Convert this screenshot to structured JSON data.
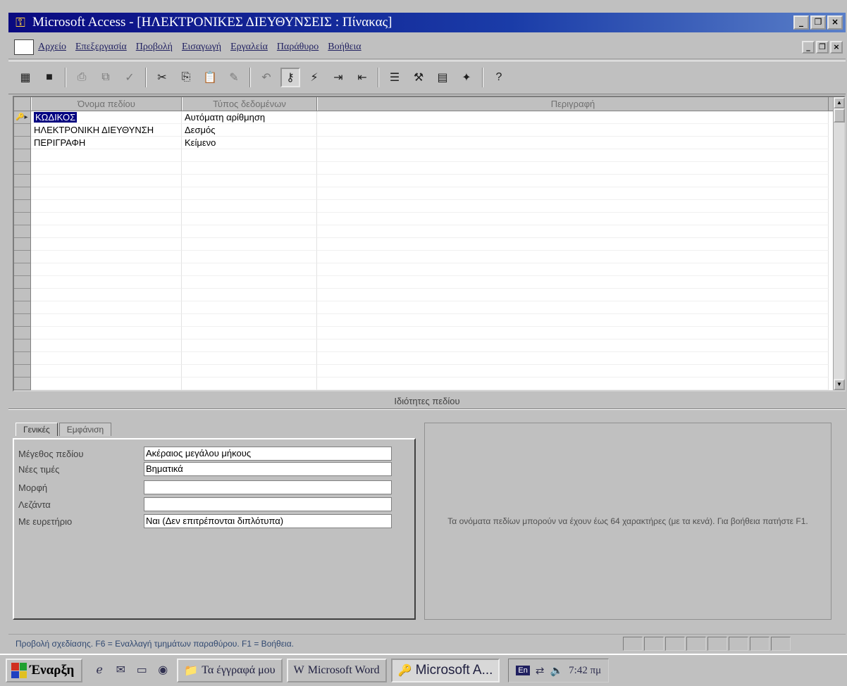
{
  "window": {
    "title": "Microsoft Access - [ΗΛΕΚΤΡΟΝΙΚΕΣ ΔΙΕΥΘΥΝΣΕΙΣ : Πίνακας]",
    "min_glyph": "_",
    "max_glyph": "❐",
    "close_glyph": "×"
  },
  "menu": {
    "items": [
      "Αρχείο",
      "Επεξεργασία",
      "Προβολή",
      "Εισαγωγή",
      "Εργαλεία",
      "Παράθυρο",
      "Βοήθεια"
    ]
  },
  "table": {
    "columns": [
      "Όνομα πεδίου",
      "Τύπος δεδομένων",
      "Περιγραφή"
    ],
    "rows": [
      {
        "key_marker": "🔑▸",
        "field": "ΚΩΔΙΚΟΣ",
        "type": "Αυτόματη αρίθμηση",
        "description": ""
      },
      {
        "key_marker": "",
        "field": "ΗΛΕΚΤΡΟΝΙΚΗ ΔΙΕΥΘΥΝΣΗ",
        "type": "Δεσμός",
        "description": ""
      },
      {
        "key_marker": "",
        "field": "ΠΕΡΙΓΡΑΦΗ",
        "type": "Κείμενο",
        "description": ""
      }
    ]
  },
  "properties": {
    "section_title": "Ιδιότητες πεδίου",
    "tabs": [
      "Γενικές",
      "Εμφάνιση"
    ],
    "fields": [
      {
        "label": "Μέγεθος πεδίου",
        "value": "Ακέραιος μεγάλου μήκους"
      },
      {
        "label": "Νέες τιμές",
        "value": "Βηματικά"
      },
      {
        "label": "Μορφή",
        "value": ""
      },
      {
        "label": "Λεζάντα",
        "value": ""
      },
      {
        "label": "Με ευρετήριο",
        "value": "Ναι (Δεν επιτρέπονται διπλότυπα)"
      }
    ],
    "help_text": "Τα ονόματα πεδίων μπορούν να έχουν έως 64 χαρακτήρες (με τα κενά). Για βοήθεια πατήστε F1."
  },
  "status": {
    "text": "Προβολή σχεδίασης. F6 = Εναλλαγή τμημάτων παραθύρου. F1 = Βοήθεια."
  },
  "taskbar": {
    "start_label": "Έναρξη",
    "buttons": [
      {
        "icon": "📁",
        "label": "Τα έγγραφά μου"
      },
      {
        "icon": "W",
        "label": "Microsoft Word"
      },
      {
        "icon": "🔑",
        "label": "Microsoft A..."
      }
    ],
    "lang": "En",
    "clock": "7:42 πμ"
  }
}
